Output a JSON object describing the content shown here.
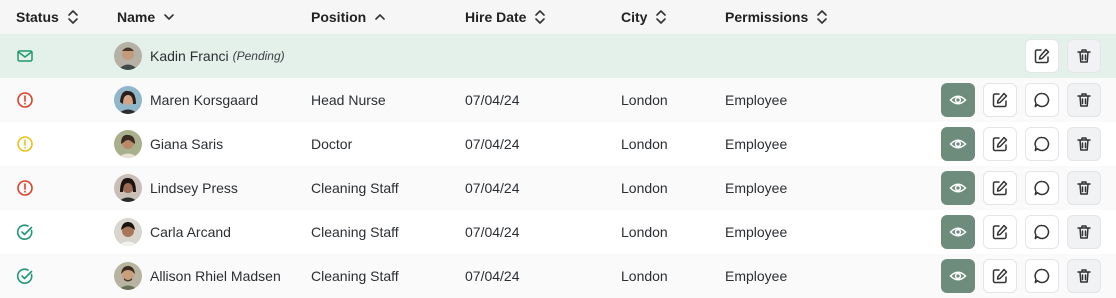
{
  "header": {
    "status": "Status",
    "name": "Name",
    "position": "Position",
    "hire_date": "Hire Date",
    "city": "City",
    "permissions": "Permissions"
  },
  "colors": {
    "header_bg": "#f5f6f5",
    "pending_row_bg": "#e4f1ea",
    "view_button": "#6e8c7c",
    "status_alert": "#d9402b",
    "status_warning": "#e6c21a",
    "status_ok": "#1f9a6e"
  },
  "pending": {
    "name": "Kadin Franci",
    "tag": "(Pending)",
    "status_icon": "mail-icon"
  },
  "rows": [
    {
      "status": "alert",
      "status_icon": "alert-circle-icon",
      "name": "Maren Korsgaard",
      "position": "Head Nurse",
      "hire_date": "07/04/24",
      "city": "London",
      "permissions": "Employee"
    },
    {
      "status": "warning",
      "status_icon": "alert-circle-icon",
      "name": "Giana Saris",
      "position": "Doctor",
      "hire_date": "07/04/24",
      "city": "London",
      "permissions": "Employee"
    },
    {
      "status": "alert",
      "status_icon": "alert-circle-icon",
      "name": "Lindsey Press",
      "position": "Cleaning Staff",
      "hire_date": "07/04/24",
      "city": "London",
      "permissions": "Employee"
    },
    {
      "status": "ok",
      "status_icon": "check-circle-icon",
      "name": "Carla Arcand",
      "position": "Cleaning Staff",
      "hire_date": "07/04/24",
      "city": "London",
      "permissions": "Employee"
    },
    {
      "status": "ok",
      "status_icon": "check-circle-icon",
      "name": "Allison Rhiel Madsen",
      "position": "Cleaning Staff",
      "hire_date": "07/04/24",
      "city": "London",
      "permissions": "Employee"
    }
  ]
}
